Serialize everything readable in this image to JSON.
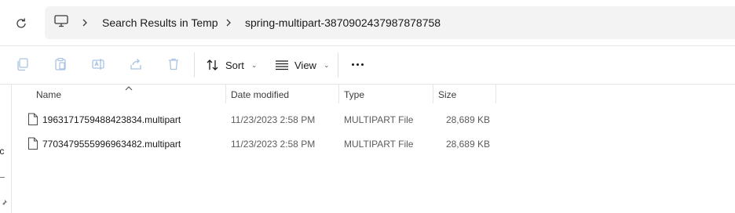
{
  "address_bar": {
    "breadcrumbs": [
      {
        "label": "Search Results in Temp"
      },
      {
        "label": "spring-multipart-3870902437987878758"
      }
    ]
  },
  "toolbar": {
    "sort_label": "Sort",
    "view_label": "View"
  },
  "nav": {
    "partial_label": "ıc"
  },
  "columns": {
    "name": "Name",
    "date": "Date modified",
    "type": "Type",
    "size": "Size"
  },
  "files": [
    {
      "name": "1963171759488423834.multipart",
      "date": "11/23/2023 2:58 PM",
      "type": "MULTIPART File",
      "size": "28,689 KB"
    },
    {
      "name": "7703479555996963482.multipart",
      "date": "11/23/2023 2:58 PM",
      "type": "MULTIPART File",
      "size": "28,689 KB"
    }
  ],
  "colors": {
    "toolbar_disabled_icon": "#a9c3e3",
    "address_bg": "#f3f3f3"
  }
}
